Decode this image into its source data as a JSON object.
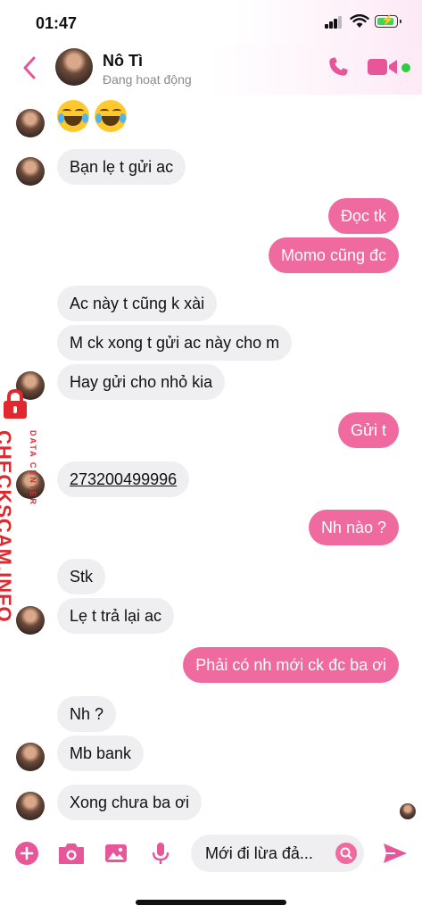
{
  "status_bar": {
    "time": "01:47"
  },
  "header": {
    "contact_name": "Nô Tì",
    "contact_status": "Đang hoạt động"
  },
  "messages": [
    {
      "side": "in",
      "text": "Bạn lẹ t gửi ac"
    },
    {
      "side": "out",
      "text": "Đọc tk"
    },
    {
      "side": "out",
      "text": "Momo cũng đc"
    },
    {
      "side": "in",
      "text": "Ac này t cũng k xài"
    },
    {
      "side": "in",
      "text": "M ck xong t gửi ac này cho m"
    },
    {
      "side": "in",
      "text": "Hay gửi cho nhỏ kia"
    },
    {
      "side": "out",
      "text": "Gửi t"
    },
    {
      "side": "in",
      "text": "273200499996"
    },
    {
      "side": "out",
      "text": "Nh nào ?"
    },
    {
      "side": "in",
      "text": "Stk"
    },
    {
      "side": "in",
      "text": "Lẹ t trả lại ac"
    },
    {
      "side": "out",
      "text": "Phải có nh mới ck đc ba ơi"
    },
    {
      "side": "in",
      "text": "Nh ?"
    },
    {
      "side": "in",
      "text": "Mb bank"
    },
    {
      "side": "in",
      "text": "Xong chưa ba ơi"
    }
  ],
  "watermark": {
    "text": "CHECKSCAM.INFO",
    "subtext": "DATA CENTER"
  },
  "composer": {
    "input_value": "Mới đi lừa đả..."
  },
  "colors": {
    "accent": "#ee6a9f",
    "incoming_bubble": "#efeff1",
    "watermark": "#e0282e",
    "online": "#2ecc40"
  }
}
